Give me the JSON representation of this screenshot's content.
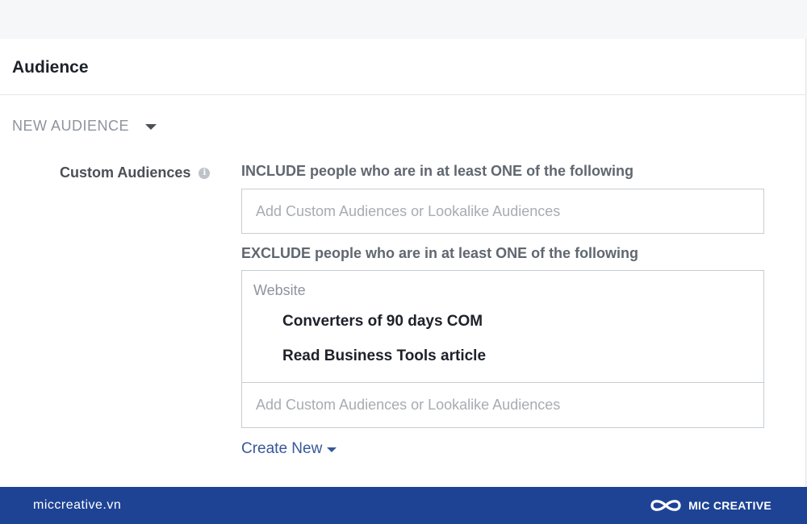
{
  "audience": {
    "title": "Audience",
    "new_audience_label": "NEW AUDIENCE",
    "custom_audiences_label": "Custom Audiences",
    "include": {
      "heading": "INCLUDE people who are in at least ONE of the following",
      "placeholder": "Add Custom Audiences or Lookalike Audiences"
    },
    "exclude": {
      "heading": "EXCLUDE people who are in at least ONE of the following",
      "group_label": "Website",
      "items": [
        "Converters of 90 days COM",
        "Read Business Tools article"
      ],
      "placeholder": "Add Custom Audiences or Lookalike Audiences"
    },
    "create_new_label": "Create New"
  },
  "footer": {
    "site": "miccreative.vn",
    "brand": "MIC CREATIVE"
  },
  "colors": {
    "link": "#365899",
    "footer_bg": "#1e4395"
  },
  "icons": [
    "info-icon",
    "caret-down-icon",
    "mic-creative-logo"
  ]
}
